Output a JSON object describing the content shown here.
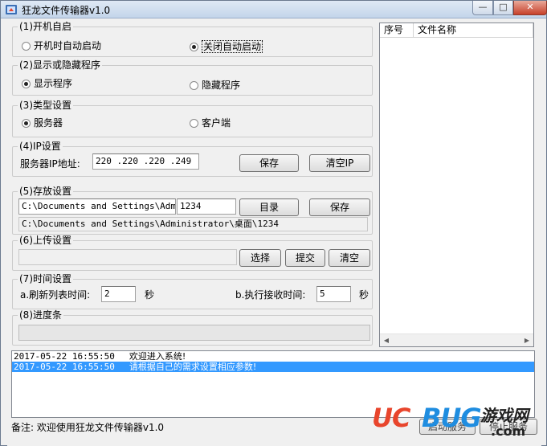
{
  "window": {
    "title": "狂龙文件传输器v1.0",
    "min_glyph": "—",
    "max_glyph": "□",
    "close_glyph": "✕"
  },
  "startup": {
    "legend": "(1)开机自启",
    "option_auto": "开机时自动启动",
    "option_off": "关闭自动启动",
    "selected": "off"
  },
  "display": {
    "legend": "(2)显示或隐藏程序",
    "option_show": "显示程序",
    "option_hide": "隐藏程序",
    "selected": "show"
  },
  "type": {
    "legend": "(3)类型设置",
    "option_server": "服务器",
    "option_client": "客户端",
    "selected": "server"
  },
  "ip": {
    "legend": "(4)IP设置",
    "label": "服务器IP地址:",
    "value": "220 .220 .220 .249",
    "save_label": "保存",
    "clear_label": "清空IP"
  },
  "storage": {
    "legend": "(5)存放设置",
    "path_value": "C:\\Documents and Settings\\Administrator\\桌面",
    "folder_value": "1234",
    "dir_label": "目录",
    "save_label": "保存",
    "full_path": "C:\\Documents and Settings\\Administrator\\桌面\\1234"
  },
  "upload": {
    "legend": "(6)上传设置",
    "value": "",
    "select_label": "选择",
    "submit_label": "提交",
    "clear_label": "清空"
  },
  "timing": {
    "legend": "(7)时间设置",
    "refresh_label": "a.刷新列表时间:",
    "refresh_value": "2",
    "refresh_unit": "秒",
    "receive_label": "b.执行接收时间:",
    "receive_value": "5",
    "receive_unit": "秒"
  },
  "progress": {
    "legend": "(8)进度条",
    "fraction": 0
  },
  "file_list": {
    "columns": [
      "序号",
      "文件名称"
    ],
    "rows": []
  },
  "log": {
    "entries": [
      {
        "time": "2017-05-22 16:55:50",
        "message": "欢迎进入系统!",
        "selected": false
      },
      {
        "time": "2017-05-22 16:55:50",
        "message": "请根据自己的需求设置相应参数!",
        "selected": true
      }
    ]
  },
  "footer": {
    "note": "备注: 欢迎使用狂龙文件传输器v1.0",
    "start_service_label": "启动服务",
    "stop_service_label": "停止服务"
  },
  "watermark": {
    "uc": "UC",
    "bug": "BUG",
    "cn": "游戏网",
    "com": ".com"
  },
  "colors": {
    "selection": "#3399ff",
    "watermark_red": "#e8452c",
    "watermark_blue": "#1f8de0"
  }
}
